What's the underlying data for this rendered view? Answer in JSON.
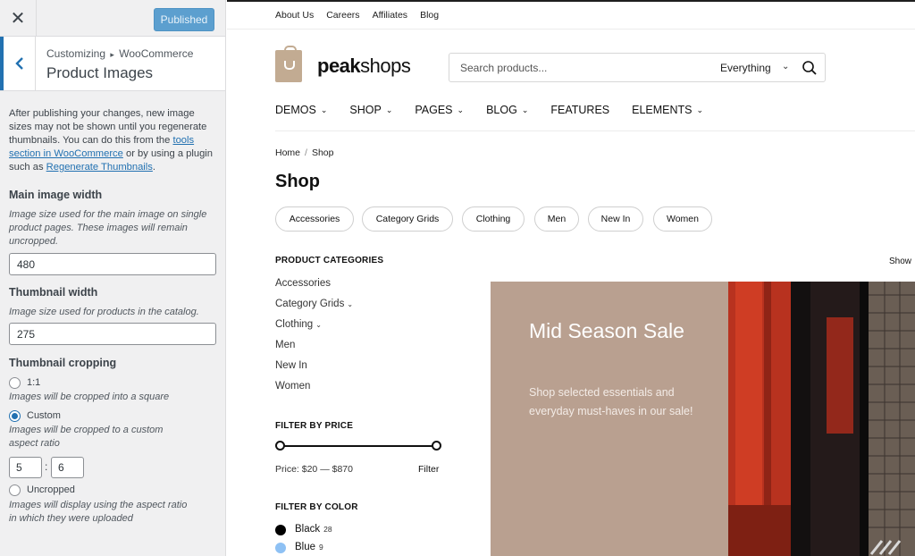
{
  "customizer": {
    "close_icon": "close-icon",
    "publish_label": "Published",
    "breadcrumb_parent": "Customizing",
    "breadcrumb_section": "WooCommerce",
    "section_title": "Product Images",
    "notice": {
      "before_tools": "After publishing your changes, new image sizes may not be shown until you regenerate thumbnails. You can do this from the ",
      "tools_link": "tools section in WooCommerce",
      "middle": " or by using a plugin such as ",
      "plugin_link": "Regenerate Thumbnails",
      "after": "."
    },
    "main_image_width": {
      "label": "Main image width",
      "help": "Image size used for the main image on single product pages. These images will remain uncropped.",
      "value": "480"
    },
    "thumbnail_width": {
      "label": "Thumbnail width",
      "help": "Image size used for products in the catalog.",
      "value": "275"
    },
    "thumbnail_cropping": {
      "label": "Thumbnail cropping",
      "options": [
        {
          "label": "1:1",
          "help": "Images will be cropped into a square",
          "selected": false
        },
        {
          "label": "Custom",
          "help": "Images will be cropped to a custom aspect ratio",
          "selected": true
        },
        {
          "label": "Uncropped",
          "help": "Images will display using the aspect ratio in which they were uploaded",
          "selected": false
        }
      ],
      "ratio_width": "5",
      "ratio_separator": ":",
      "ratio_height": "6"
    }
  },
  "site": {
    "top_links": [
      "About Us",
      "Careers",
      "Affiliates",
      "Blog"
    ],
    "logo_bold": "peak",
    "logo_rest": "shops",
    "search": {
      "placeholder": "Search products...",
      "category": "Everything"
    },
    "main_nav": [
      {
        "label": "DEMOS",
        "has_dropdown": true
      },
      {
        "label": "SHOP",
        "has_dropdown": true
      },
      {
        "label": "PAGES",
        "has_dropdown": true
      },
      {
        "label": "BLOG",
        "has_dropdown": true
      },
      {
        "label": "FEATURES",
        "has_dropdown": false
      },
      {
        "label": "ELEMENTS",
        "has_dropdown": true
      }
    ],
    "breadcrumb": {
      "home": "Home",
      "separator": "/",
      "current": "Shop"
    },
    "page_title": "Shop",
    "category_pills": [
      "Accessories",
      "Category Grids",
      "Clothing",
      "Men",
      "New In",
      "Women"
    ],
    "product_categories": {
      "title": "PRODUCT CATEGORIES",
      "items": [
        {
          "label": "Accessories",
          "has_children": false
        },
        {
          "label": "Category Grids",
          "has_children": true
        },
        {
          "label": "Clothing",
          "has_children": true
        },
        {
          "label": "Men",
          "has_children": false
        },
        {
          "label": "New In",
          "has_children": false
        },
        {
          "label": "Women",
          "has_children": false
        }
      ]
    },
    "show_label": "Show",
    "filter_by_price": {
      "title": "FILTER BY PRICE",
      "price_text": "Price: $20 — $870",
      "filter_label": "Filter"
    },
    "filter_by_color": {
      "title": "FILTER BY COLOR",
      "colors": [
        {
          "name": "Black",
          "count": "28",
          "hex": "#000000"
        },
        {
          "name": "Blue",
          "count": "9",
          "hex": "#8ec1f4"
        }
      ]
    },
    "hero": {
      "title": "Mid Season Sale",
      "subtitle": "Shop selected essentials and everyday must-haves in our sale!",
      "background": "#b9a090"
    }
  }
}
